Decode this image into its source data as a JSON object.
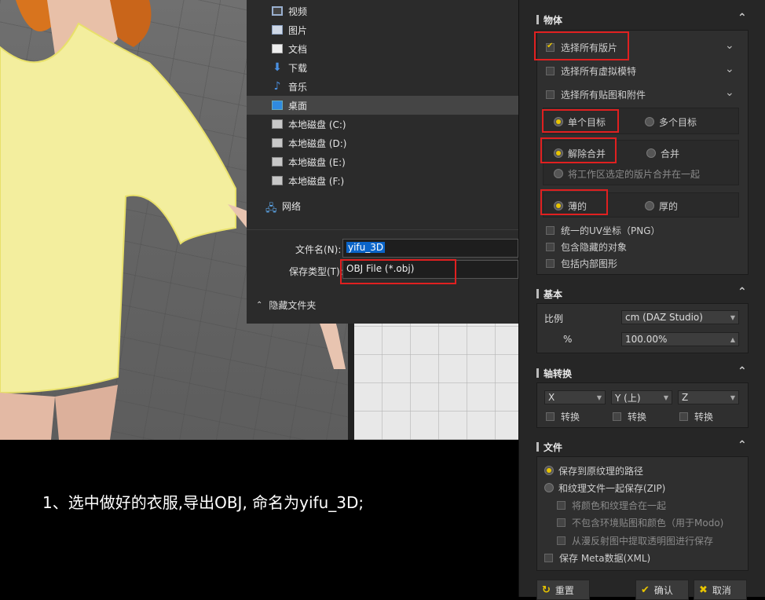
{
  "file_dialog": {
    "nav_items": [
      {
        "label": "视频",
        "icon": "video-folder-icon"
      },
      {
        "label": "图片",
        "icon": "pictures-folder-icon"
      },
      {
        "label": "文档",
        "icon": "documents-folder-icon"
      },
      {
        "label": "下载",
        "icon": "download-arrow-icon"
      },
      {
        "label": "音乐",
        "icon": "music-note-icon"
      },
      {
        "label": "桌面",
        "icon": "desktop-icon"
      },
      {
        "label": "本地磁盘 (C:)",
        "icon": "drive-c-icon"
      },
      {
        "label": "本地磁盘 (D:)",
        "icon": "drive-icon"
      },
      {
        "label": "本地磁盘 (E:)",
        "icon": "drive-icon"
      },
      {
        "label": "本地磁盘 (F:)",
        "icon": "drive-icon"
      },
      {
        "label": "网络",
        "icon": "network-icon"
      }
    ],
    "filename_label": "文件名(N):",
    "filename_value": "yifu_3D",
    "filetype_label": "保存类型(T):",
    "filetype_value": "OBJ File (*.obj)",
    "hide_folders": "隐藏文件夹"
  },
  "panel": {
    "section_object": "物体",
    "select_all_patterns": "选择所有版片",
    "select_all_avatars": "选择所有虚拟模特",
    "select_all_graphics": "选择所有贴图和附件",
    "single_target": "单个目标",
    "multi_target": "多个目标",
    "unmerge": "解除合并",
    "merge": "合并",
    "merge_selected": "将工作区选定的版片合并在一起",
    "thin": "薄的",
    "thick": "厚的",
    "unified_uv": "统一的UV坐标（PNG）",
    "include_hidden": "包含隐藏的对象",
    "include_inner": "包括内部图形",
    "section_basic": "基本",
    "scale_label": "比例",
    "scale_value": "cm (DAZ Studio)",
    "percent_label": "%",
    "percent_value": "100.00%",
    "section_axis": "轴转换",
    "axis_x": "X",
    "axis_y": "Y (上)",
    "axis_z": "Z",
    "convert": "转换",
    "section_file": "文件",
    "save_to_texture_path": "保存到原纹理的路径",
    "save_with_texture_zip": "和纹理文件一起保存(ZIP)",
    "merge_color_texture": "将颜色和纹理合在一起",
    "exclude_env": "不包含环境贴图和颜色（用于Modo)",
    "extract_opacity": "从漫反射图中提取透明图进行保存",
    "save_meta": "保存 Meta数据(XML)",
    "reset": "重置",
    "confirm": "确认",
    "cancel": "取消"
  },
  "caption": "1、选中做好的衣服,导出OBJ, 命名为yifu_3D;"
}
